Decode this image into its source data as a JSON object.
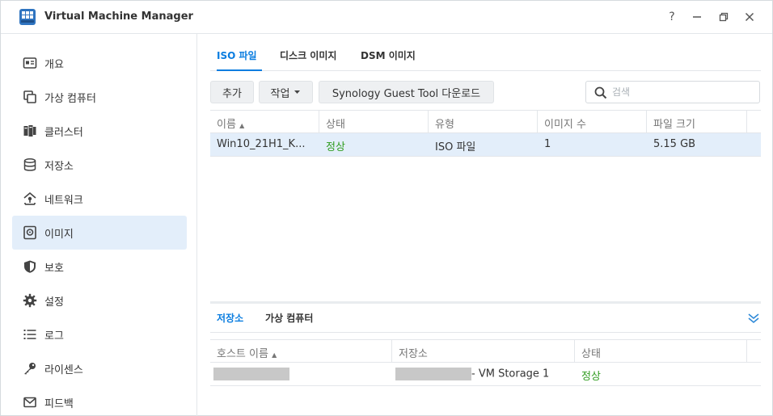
{
  "window": {
    "title": "Virtual Machine Manager",
    "controls": {
      "help": "?",
      "minimize": "—",
      "restore": "❐",
      "close": "✕"
    }
  },
  "sidebar": {
    "items": [
      {
        "label": "개요",
        "icon": "overview-icon",
        "active": false
      },
      {
        "label": "가상 컴퓨터",
        "icon": "virtual-machine-icon",
        "active": false
      },
      {
        "label": "클러스터",
        "icon": "cluster-icon",
        "active": false
      },
      {
        "label": "저장소",
        "icon": "storage-icon",
        "active": false
      },
      {
        "label": "네트워크",
        "icon": "network-icon",
        "active": false
      },
      {
        "label": "이미지",
        "icon": "image-icon",
        "active": true
      },
      {
        "label": "보호",
        "icon": "protection-icon",
        "active": false
      },
      {
        "label": "설정",
        "icon": "settings-icon",
        "active": false
      },
      {
        "label": "로그",
        "icon": "log-icon",
        "active": false
      },
      {
        "label": "라이센스",
        "icon": "license-icon",
        "active": false
      },
      {
        "label": "피드백",
        "icon": "feedback-icon",
        "active": false
      }
    ]
  },
  "tabs": [
    {
      "label": "ISO 파일",
      "active": true
    },
    {
      "label": "디스크 이미지",
      "active": false
    },
    {
      "label": "DSM 이미지",
      "active": false
    }
  ],
  "toolbar": {
    "add": "추가",
    "action": "작업",
    "download": "Synology Guest Tool 다운로드",
    "search_placeholder": "검색"
  },
  "iso_table": {
    "columns": [
      "이름",
      "상태",
      "유형",
      "이미지 수",
      "파일 크기"
    ],
    "sort_indicator": "▲",
    "rows": [
      {
        "name": "Win10_21H1_K...",
        "status": "정상",
        "type": "ISO 파일",
        "count": "1",
        "size": "5.15 GB",
        "selected": true
      }
    ]
  },
  "bottom_tabs": [
    {
      "label": "저장소",
      "active": true
    },
    {
      "label": "가상 컴퓨터",
      "active": false
    }
  ],
  "storage_table": {
    "columns": [
      "호스트 이름",
      "저장소",
      "상태"
    ],
    "sort_indicator": "▲",
    "rows": [
      {
        "host": "",
        "storage_suffix": "- VM Storage 1",
        "status": "정상"
      }
    ]
  },
  "colors": {
    "accent": "#0a7de0",
    "status_ok": "#2f9c1f",
    "selection": "#e3eefa",
    "app_icon": "#2f74c0"
  }
}
